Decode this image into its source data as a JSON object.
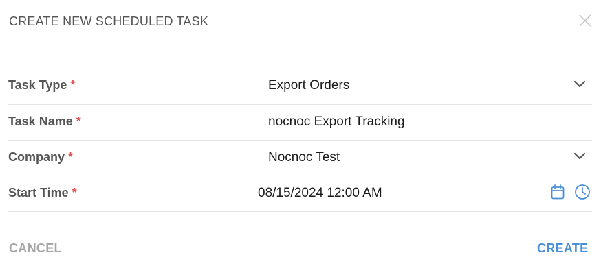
{
  "dialog": {
    "title": "CREATE NEW SCHEDULED TASK"
  },
  "form": {
    "required_marker": "*",
    "task_type": {
      "label": "Task Type",
      "value": "Export Orders"
    },
    "task_name": {
      "label": "Task Name",
      "value": "nocnoc Export Tracking"
    },
    "company": {
      "label": "Company",
      "value": "Nocnoc Test"
    },
    "start_time": {
      "label": "Start Time",
      "value": "08/15/2024 12:00 AM"
    }
  },
  "actions": {
    "cancel_label": "CANCEL",
    "create_label": "CREATE"
  },
  "icons": {
    "close": "close-icon",
    "dropdown": "chevron-down-icon",
    "calendar": "calendar-icon",
    "clock": "clock-icon"
  },
  "colors": {
    "required": "#e0524f",
    "accent": "#4a90d9",
    "muted": "#a6a6a6"
  }
}
